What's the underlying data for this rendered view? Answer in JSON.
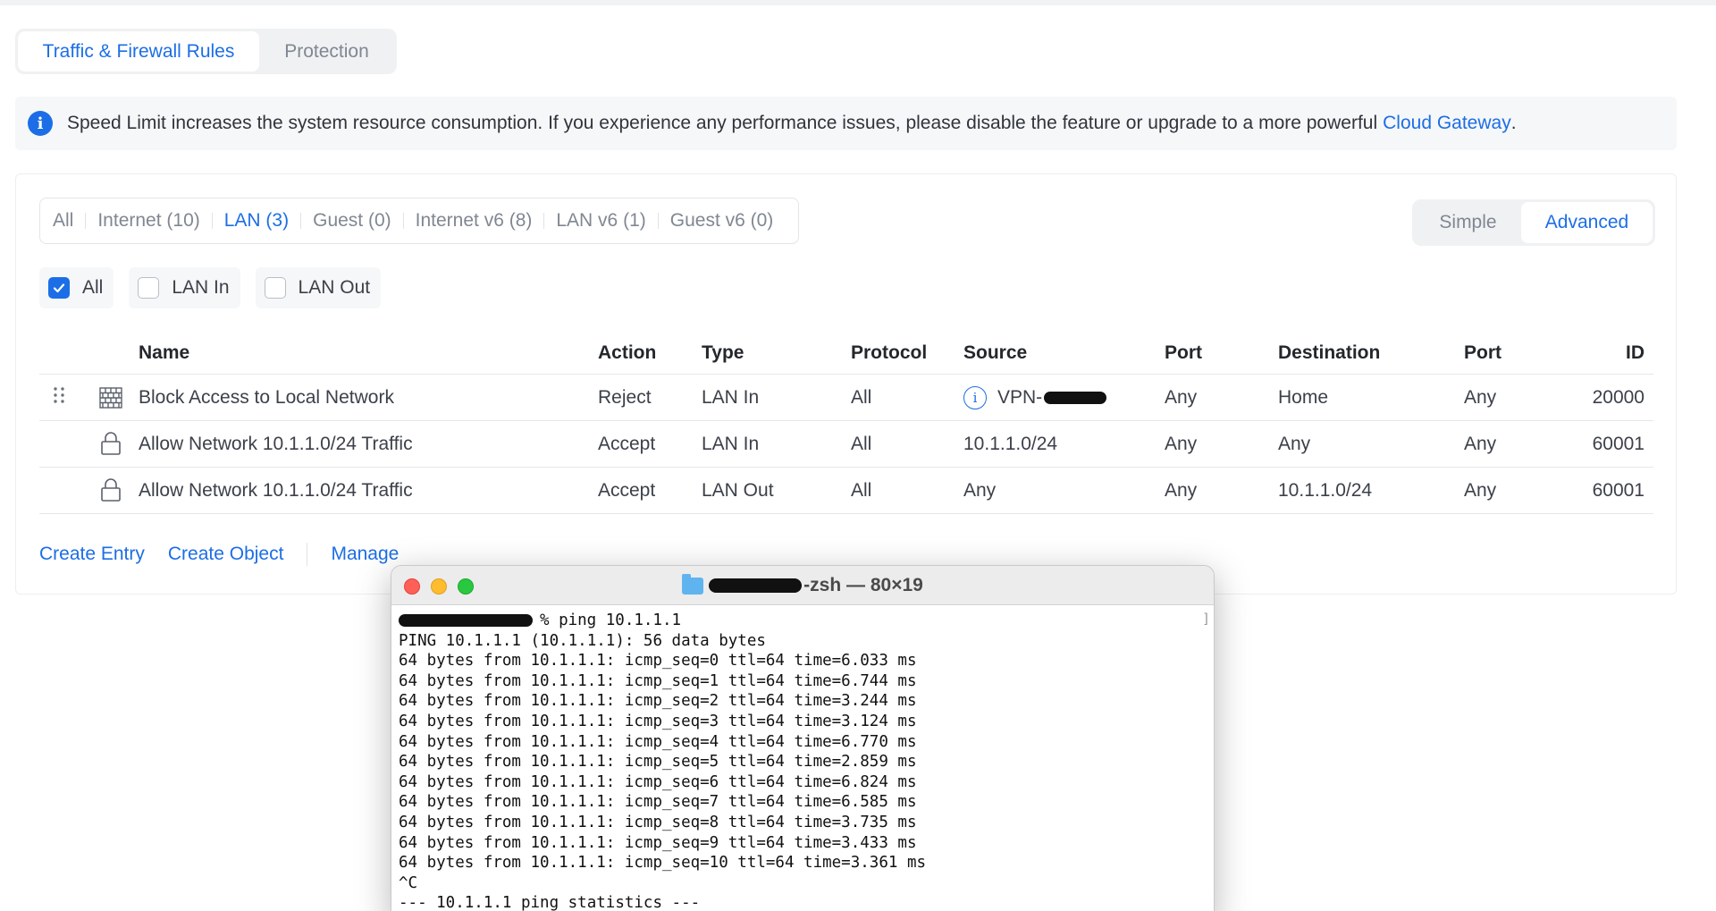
{
  "tabs": [
    {
      "label": "Traffic & Firewall Rules",
      "active": true
    },
    {
      "label": "Protection",
      "active": false
    }
  ],
  "banner": {
    "text": "Speed Limit increases the system resource consumption. If you experience any performance issues, please disable the feature or upgrade to a more powerful",
    "link": "Cloud Gateway",
    "suffix": "."
  },
  "filters": [
    {
      "label": "All",
      "active": false
    },
    {
      "label": "Internet (10)",
      "active": false
    },
    {
      "label": "LAN (3)",
      "active": true
    },
    {
      "label": "Guest (0)",
      "active": false
    },
    {
      "label": "Internet v6 (8)",
      "active": false
    },
    {
      "label": "LAN v6 (1)",
      "active": false
    },
    {
      "label": "Guest v6 (0)",
      "active": false
    }
  ],
  "view_toggle": {
    "simple": "Simple",
    "advanced": "Advanced",
    "active": "Advanced"
  },
  "checks": [
    {
      "label": "All",
      "checked": true
    },
    {
      "label": "LAN In",
      "checked": false
    },
    {
      "label": "LAN Out",
      "checked": false
    }
  ],
  "table": {
    "headers": {
      "name": "Name",
      "action": "Action",
      "type": "Type",
      "protocol": "Protocol",
      "source": "Source",
      "port": "Port",
      "destination": "Destination",
      "port2": "Port",
      "id": "ID"
    },
    "rows": [
      {
        "icon": "firewall-brick-icon",
        "name": "Block Access to Local Network",
        "action": "Reject",
        "type": "LAN In",
        "protocol": "All",
        "source": "VPN-",
        "port": "Any",
        "destination": "Home",
        "port2": "Any",
        "id": "20000"
      },
      {
        "icon": "lock-icon",
        "name": "Allow Network 10.1.1.0/24 Traffic",
        "action": "Accept",
        "type": "LAN In",
        "protocol": "All",
        "source": "10.1.1.0/24",
        "port": "Any",
        "destination": "Any",
        "port2": "Any",
        "id": "60001"
      },
      {
        "icon": "lock-icon",
        "name": "Allow Network 10.1.1.0/24 Traffic",
        "action": "Accept",
        "type": "LAN Out",
        "protocol": "All",
        "source": "Any",
        "port": "Any",
        "destination": "10.1.1.0/24",
        "port2": "Any",
        "id": "60001"
      }
    ]
  },
  "actions": {
    "create_entry": "Create Entry",
    "create_object": "Create Object",
    "manage": "Manage"
  },
  "terminal": {
    "title": "-zsh — 80×19",
    "command": "% ping 10.1.1.1",
    "lines": [
      "PING 10.1.1.1 (10.1.1.1): 56 data bytes",
      "64 bytes from 10.1.1.1: icmp_seq=0 ttl=64 time=6.033 ms",
      "64 bytes from 10.1.1.1: icmp_seq=1 ttl=64 time=6.744 ms",
      "64 bytes from 10.1.1.1: icmp_seq=2 ttl=64 time=3.244 ms",
      "64 bytes from 10.1.1.1: icmp_seq=3 ttl=64 time=3.124 ms",
      "64 bytes from 10.1.1.1: icmp_seq=4 ttl=64 time=6.770 ms",
      "64 bytes from 10.1.1.1: icmp_seq=5 ttl=64 time=2.859 ms",
      "64 bytes from 10.1.1.1: icmp_seq=6 ttl=64 time=6.824 ms",
      "64 bytes from 10.1.1.1: icmp_seq=7 ttl=64 time=6.585 ms",
      "64 bytes from 10.1.1.1: icmp_seq=8 ttl=64 time=3.735 ms",
      "64 bytes from 10.1.1.1: icmp_seq=9 ttl=64 time=3.433 ms",
      "64 bytes from 10.1.1.1: icmp_seq=10 ttl=64 time=3.361 ms",
      "^C",
      "--- 10.1.1.1 ping statistics ---"
    ]
  },
  "colors": {
    "accent": "#1c6ee6",
    "muted": "#808792",
    "text": "#3c4049"
  }
}
